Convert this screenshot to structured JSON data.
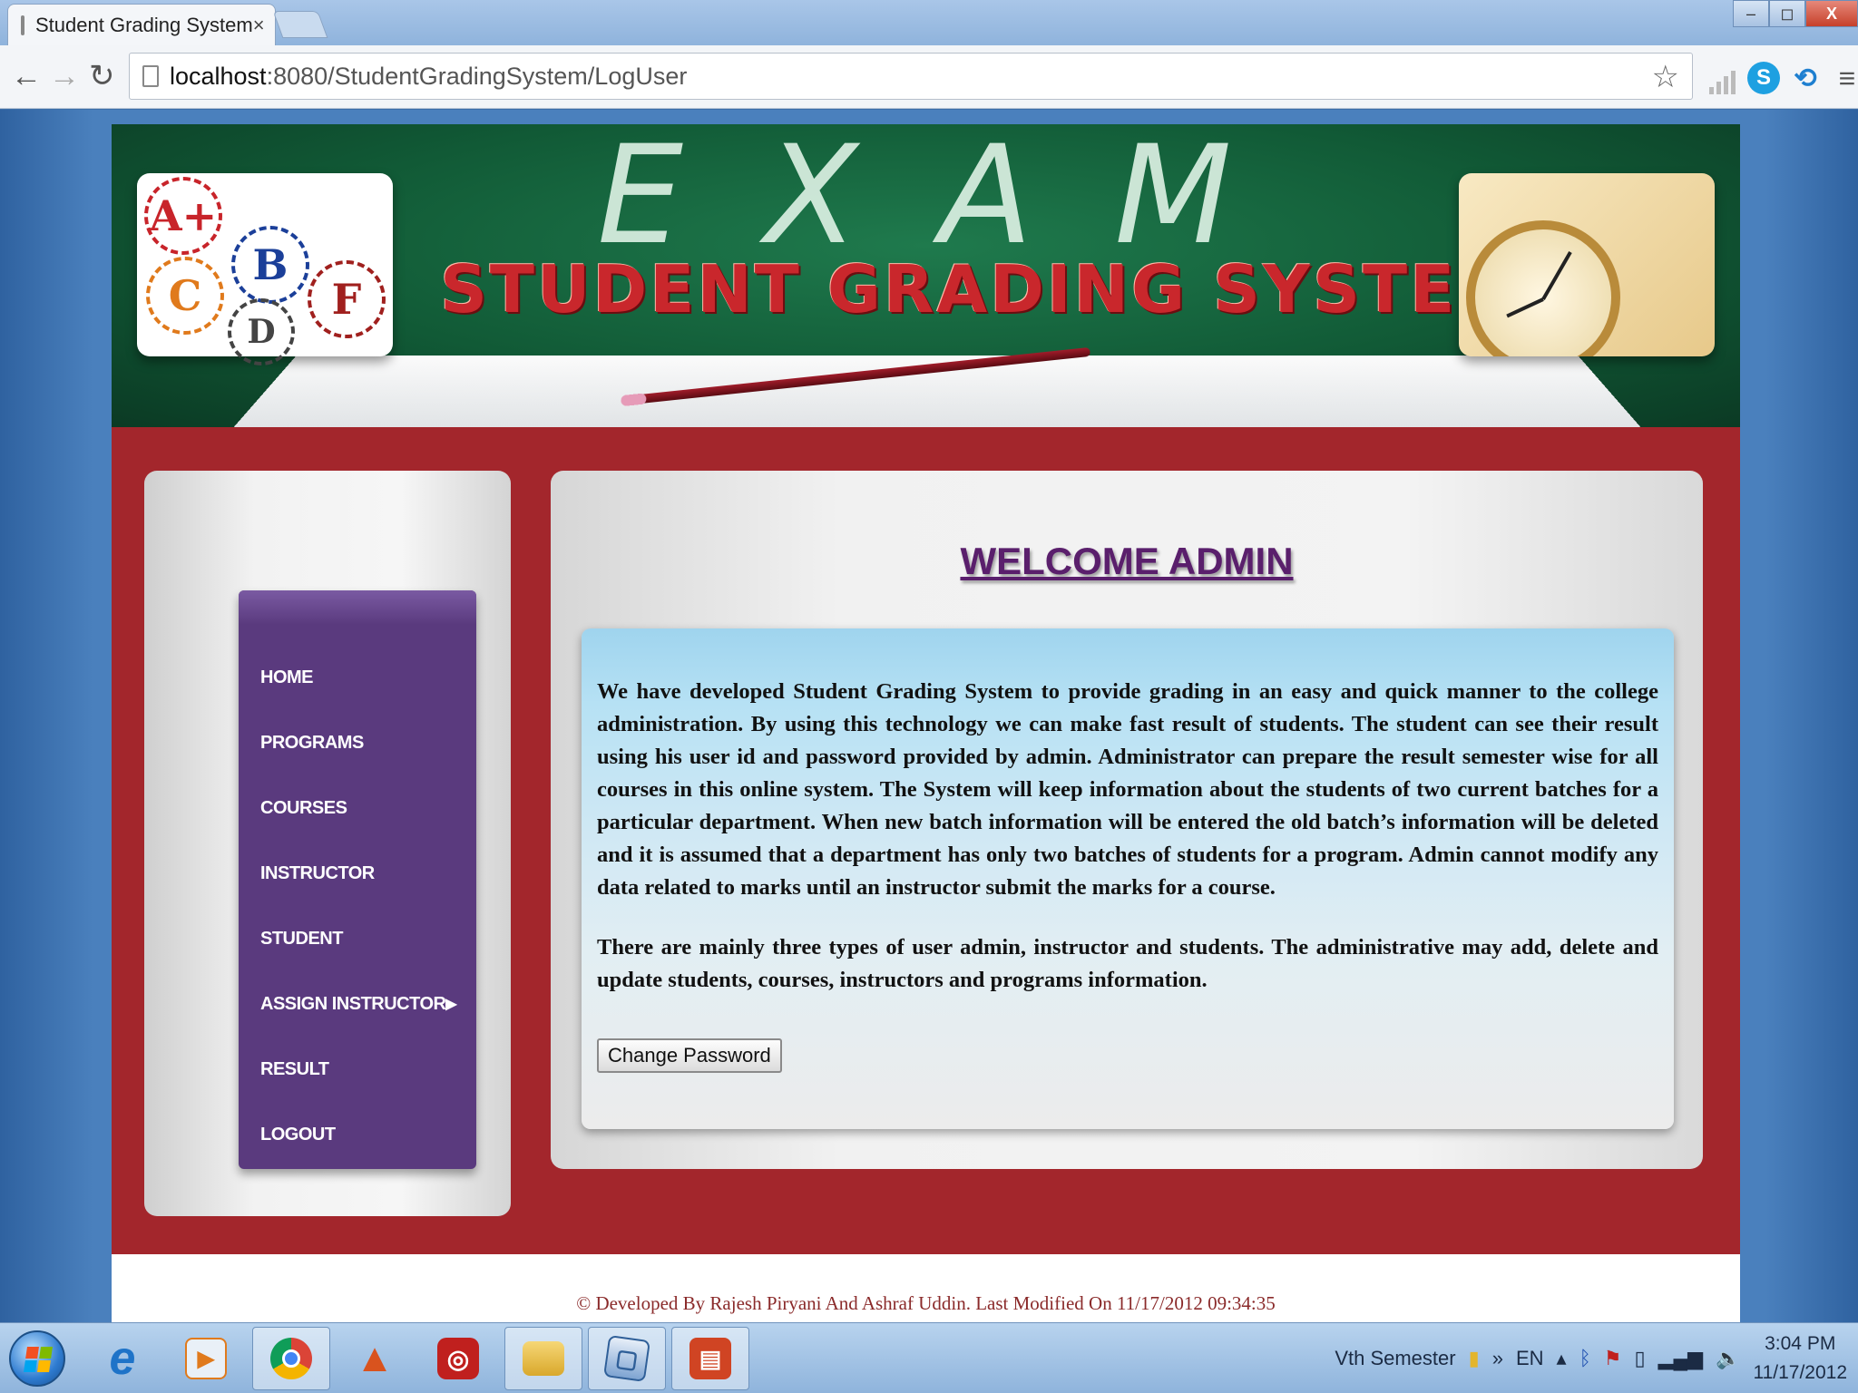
{
  "browser": {
    "tab_title": "Student Grading System",
    "tab_close": "×",
    "url_host": "localhost",
    "url_rest": ":8080/StudentGradingSystem/LogUser",
    "window_controls": {
      "minimize": "–",
      "maximize": "◻",
      "close": "X"
    }
  },
  "banner": {
    "exam_text": "EXAM",
    "title": "STUDENT GRADING SYSTEM",
    "grades": [
      "A+",
      "B",
      "C",
      "F",
      "D"
    ]
  },
  "sidebar": {
    "items": [
      {
        "label": "HOME"
      },
      {
        "label": "PROGRAMS"
      },
      {
        "label": "COURSES"
      },
      {
        "label": "INSTRUCTOR"
      },
      {
        "label": "STUDENT"
      },
      {
        "label": "ASSIGN INSTRUCTOR",
        "submenu_arrow": "▶"
      },
      {
        "label": "RESULT"
      },
      {
        "label": "LOGOUT"
      }
    ]
  },
  "main": {
    "heading": "WELCOME ADMIN",
    "paragraph1": "We have developed Student Grading System to provide grading in an easy and quick manner to the college administration. By using this technology we can make fast result of students. The student can see their result using his user id and password provided by admin. Administrator can prepare the result semester wise for all courses in this online system. The System will keep information about the students of two current batches for a particular department. When new batch information will be entered the old batch’s information will be deleted and it is assumed that a department has only two batches of students for a program. Admin cannot modify any data related to marks until an instructor submit the marks for a course.",
    "paragraph2": "There are mainly three types of user admin, instructor and students. The administrative may add, delete and update students, courses, instructors and programs information.",
    "change_password_label": "Change Password"
  },
  "footer": {
    "text": "© Developed By Rajesh Piryani And Ashraf Uddin. Last Modified On 11/17/2012 09:34:35"
  },
  "taskbar": {
    "tray_toolbar": "Vth Semester",
    "tray_chevron": "»",
    "language": "EN",
    "time": "3:04 PM",
    "date": "11/17/2012"
  }
}
